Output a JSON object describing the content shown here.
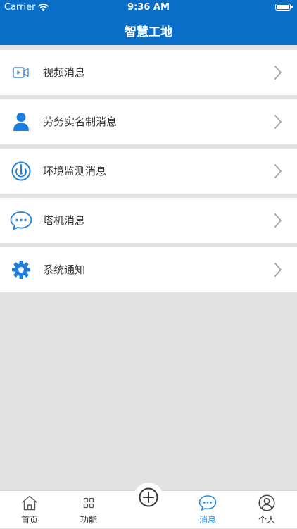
{
  "status_bar": {
    "carrier": "Carrier",
    "time": "9:36 AM"
  },
  "header": {
    "title": "智慧工地"
  },
  "menu": {
    "items": [
      {
        "label": "视频消息",
        "icon": "video-icon"
      },
      {
        "label": "劳务实名制消息",
        "icon": "person-icon"
      },
      {
        "label": "环境监测消息",
        "icon": "gauge-icon"
      },
      {
        "label": "塔机消息",
        "icon": "chat-bubble-icon"
      },
      {
        "label": "系统通知",
        "icon": "gear-icon"
      }
    ]
  },
  "tabbar": {
    "tabs": [
      {
        "label": "首页",
        "icon": "home-icon"
      },
      {
        "label": "功能",
        "icon": "grid-icon"
      },
      {
        "label": "消息",
        "icon": "message-icon",
        "active": true
      },
      {
        "label": "个人",
        "icon": "user-circle-icon"
      }
    ],
    "center_icon": "plus-circle-icon"
  },
  "colors": {
    "header": "#0a6ec9",
    "accent": "#1c86e6",
    "background": "#e2e2e2"
  }
}
